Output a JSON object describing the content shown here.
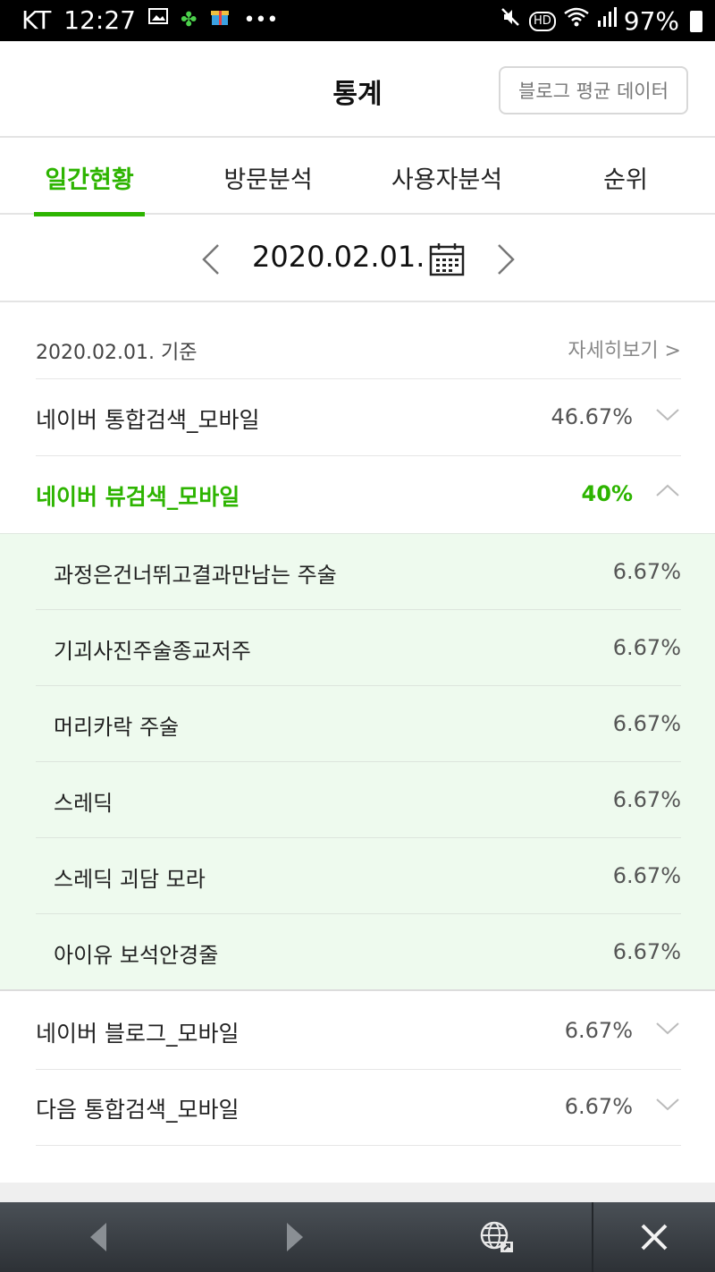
{
  "status_bar": {
    "carrier": "KT",
    "time": "12:27",
    "battery": "97%"
  },
  "header": {
    "title": "통계",
    "avg_button": "블로그 평균 데이터"
  },
  "tabs": [
    {
      "label": "일간현황",
      "active": true
    },
    {
      "label": "방문분석",
      "active": false
    },
    {
      "label": "사용자분석",
      "active": false
    },
    {
      "label": "순위",
      "active": false
    }
  ],
  "date_nav": {
    "date": "2020.02.01."
  },
  "summary": {
    "basis": "2020.02.01. 기준",
    "detail_link": "자세히보기 >"
  },
  "sources": [
    {
      "name": "네이버 통합검색_모바일",
      "percent": "46.67%",
      "expanded": false
    },
    {
      "name": "네이버 뷰검색_모바일",
      "percent": "40%",
      "expanded": true
    },
    {
      "name": "네이버 블로그_모바일",
      "percent": "6.67%",
      "expanded": false
    },
    {
      "name": "다음 통합검색_모바일",
      "percent": "6.67%",
      "expanded": false
    }
  ],
  "keywords": [
    {
      "name": "과정은건너뛰고결과만남는 주술",
      "percent": "6.67%"
    },
    {
      "name": "기괴사진주술종교저주",
      "percent": "6.67%"
    },
    {
      "name": "머리카락 주술",
      "percent": "6.67%"
    },
    {
      "name": "스레딕",
      "percent": "6.67%"
    },
    {
      "name": "스레딕 괴담 모라",
      "percent": "6.67%"
    },
    {
      "name": "아이유 보석안경줄",
      "percent": "6.67%"
    }
  ],
  "colors": {
    "accent": "#2db400",
    "expanded_bg": "#eefaee"
  }
}
